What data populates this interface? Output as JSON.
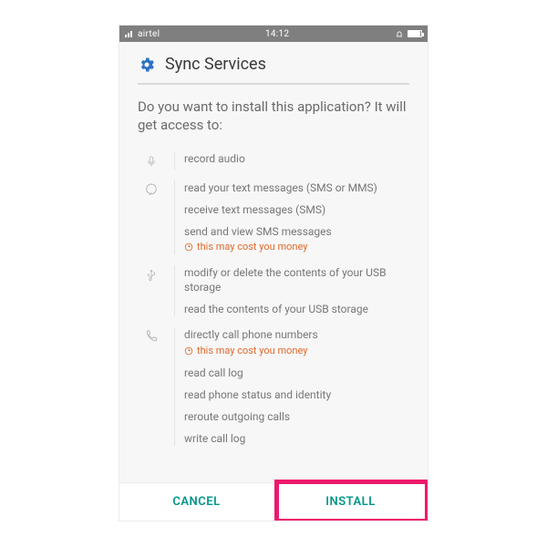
{
  "statusbar": {
    "carrier": "airtel",
    "time": "14:12"
  },
  "app": {
    "title": "Sync Services"
  },
  "question": "Do you want to install this application? It will get access to:",
  "groups": [
    {
      "icon": "mic",
      "items": [
        {
          "text": "record audio"
        }
      ]
    },
    {
      "icon": "chat",
      "items": [
        {
          "text": "read your text messages (SMS or MMS)"
        },
        {
          "text": "receive text messages (SMS)"
        },
        {
          "text": "send and view SMS messages",
          "warn": "this may cost you money"
        }
      ]
    },
    {
      "icon": "usb",
      "items": [
        {
          "text": "modify or delete the contents of your USB storage"
        },
        {
          "text": "read the contents of your USB storage"
        }
      ]
    },
    {
      "icon": "phone",
      "items": [
        {
          "text": "directly call phone numbers",
          "warn": "this may cost you money"
        },
        {
          "text": "read call log"
        },
        {
          "text": "read phone status and identity"
        },
        {
          "text": "reroute outgoing calls"
        },
        {
          "text": "write call log"
        }
      ]
    }
  ],
  "buttons": {
    "cancel": "CANCEL",
    "install": "INSTALL"
  },
  "colors": {
    "accent": "#009688",
    "warn": "#e06a2d",
    "highlight": "#ec1a6c"
  }
}
